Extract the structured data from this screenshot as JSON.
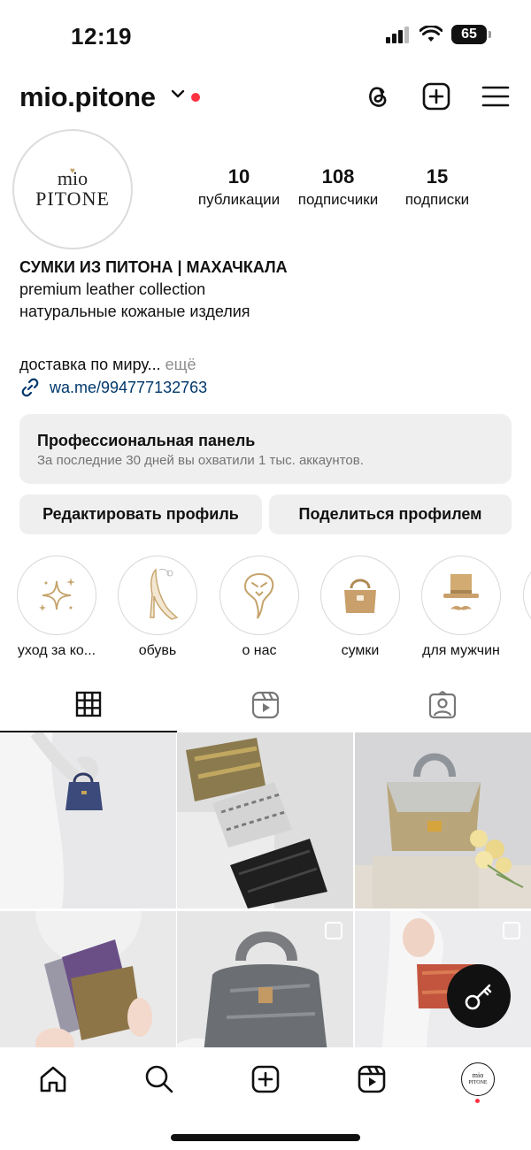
{
  "status_bar": {
    "time": "12:19",
    "battery": "65"
  },
  "header": {
    "username": "mio.pitone",
    "icons": [
      "threads-icon",
      "create-icon",
      "menu-icon"
    ]
  },
  "profile": {
    "avatar": {
      "line1": "mio",
      "line2": "PITONE"
    },
    "stats": [
      {
        "num": "10",
        "label": "публикации"
      },
      {
        "num": "108",
        "label": "подписчики"
      },
      {
        "num": "15",
        "label": "подписки"
      }
    ],
    "bio": {
      "name": "СУМКИ ИЗ ПИТОНА | МАХАЧКАЛА",
      "line1": "premium leather collection",
      "line2": "натуральные кожаные изделия",
      "line3": "доставка по миру...",
      "more": "ещё"
    },
    "link": "wa.me/994777132763"
  },
  "pro_panel": {
    "title": "Профессиональная панель",
    "subtitle": "За последние 30 дней вы охватили 1 тыс. аккаунтов."
  },
  "buttons": {
    "edit": "Редактировать профиль",
    "share": "Поделиться профилем"
  },
  "highlights": [
    {
      "label": "уход за ко...",
      "icon": "sparkles-icon"
    },
    {
      "label": "обувь",
      "icon": "high-heel-icon"
    },
    {
      "label": "о нас",
      "icon": "snake-icon"
    },
    {
      "label": "сумки",
      "icon": "handbag-icon"
    },
    {
      "label": "для мужчин",
      "icon": "top-hat-icon"
    }
  ],
  "tabs": [
    "grid-icon",
    "reels-icon",
    "tagged-icon"
  ],
  "bottom_nav": [
    "home-icon",
    "search-icon",
    "create-icon",
    "reels-icon",
    "profile-avatar"
  ],
  "colors": {
    "accent_red": "#ff3040",
    "gold": "#c5a36b",
    "panel_bg": "#efefef",
    "link": "#00376b"
  }
}
